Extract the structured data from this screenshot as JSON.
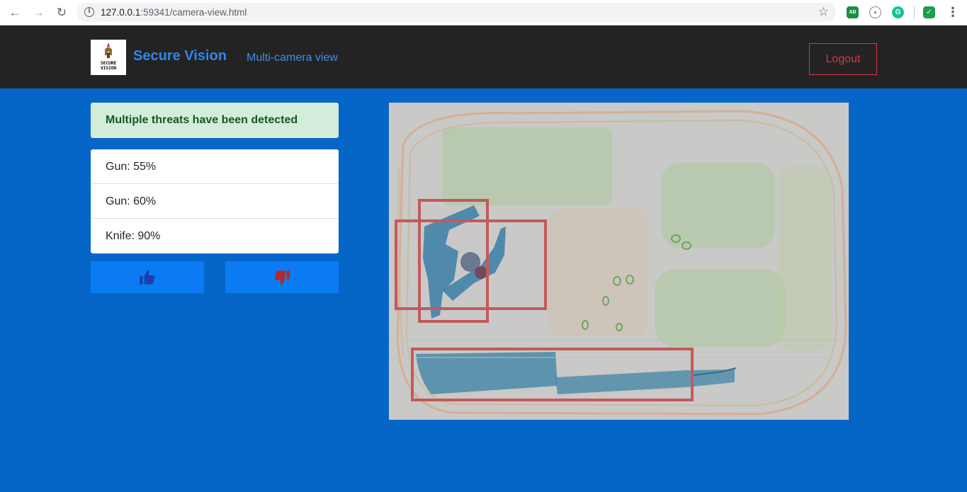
{
  "browser": {
    "url_host": "127.0.0.1",
    "url_path": ":59341/camera-view.html",
    "nav": [
      "back-icon",
      "forward-icon",
      "reload-icon"
    ],
    "extensions": [
      "adblock-icon",
      "drive-icon",
      "grammarly-icon",
      "shield-check-icon"
    ]
  },
  "header": {
    "logo_text_1": "SECURE",
    "logo_text_2": "VISION",
    "brand": "Secure Vision",
    "nav_link": "Multi-camera view",
    "logout_label": "Logout"
  },
  "alert": {
    "message": "Multiple threats have been detected"
  },
  "detections": [
    {
      "label": "Gun: 55%"
    },
    {
      "label": "Gun: 60%"
    },
    {
      "label": "Knife: 90%"
    }
  ],
  "feedback": {
    "approve_icon": "thumbs-up-icon",
    "reject_icon": "thumbs-down-icon"
  },
  "colors": {
    "background": "#0566c8",
    "navbar": "#232323",
    "brand": "#2f86ea",
    "alert_bg": "#d4edda",
    "alert_text": "#155724",
    "logout": "#dc3545",
    "bbox": "#c25a5a",
    "button": "#0b7bf4"
  }
}
